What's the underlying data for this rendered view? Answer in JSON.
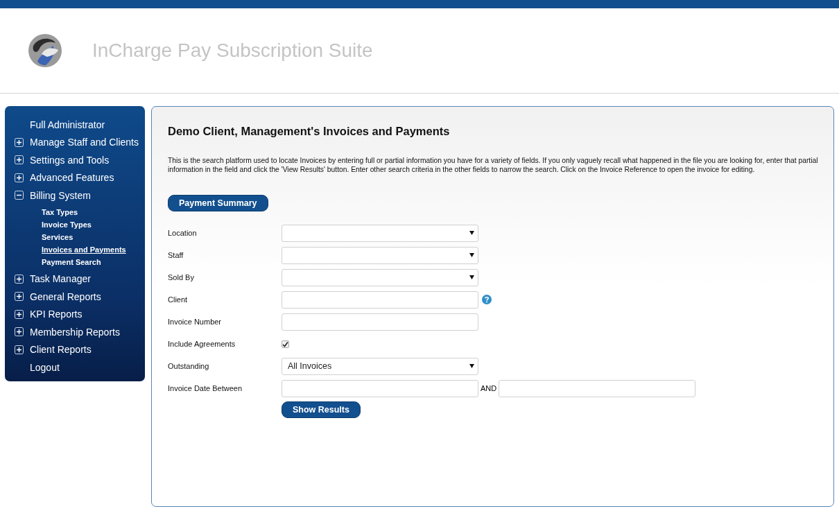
{
  "header": {
    "title": "InCharge Pay Subscription Suite"
  },
  "sidebar": {
    "items": [
      {
        "kind": "plain",
        "label": "Full Administrator"
      },
      {
        "kind": "group",
        "label": "Manage Staff and Clients",
        "expanded": false
      },
      {
        "kind": "group",
        "label": "Settings and Tools",
        "expanded": false
      },
      {
        "kind": "group",
        "label": "Advanced Features",
        "expanded": false
      },
      {
        "kind": "group",
        "label": "Billing System",
        "expanded": true,
        "children": [
          {
            "label": "Tax Types",
            "selected": false
          },
          {
            "label": "Invoice Types",
            "selected": false
          },
          {
            "label": "Services",
            "selected": false
          },
          {
            "label": "Invoices and Payments",
            "selected": true
          },
          {
            "label": "Payment Search",
            "selected": false
          }
        ]
      },
      {
        "kind": "group",
        "label": "Task Manager",
        "expanded": false
      },
      {
        "kind": "group",
        "label": "General Reports",
        "expanded": false
      },
      {
        "kind": "group",
        "label": "KPI Reports",
        "expanded": false
      },
      {
        "kind": "group",
        "label": "Membership Reports",
        "expanded": false
      },
      {
        "kind": "group",
        "label": "Client Reports",
        "expanded": false
      },
      {
        "kind": "plain",
        "label": "Logout"
      }
    ]
  },
  "main": {
    "title": "Demo Client, Management's Invoices and Payments",
    "description": "This is the search platform used to locate Invoices by entering full or partial information you have for a variety of fields. If you only vaguely recall what happened in the file you are looking for, enter that partial information in the field and click the 'View Results' button. Enter other search criteria in the other fields to narrow the search. Click on the Invoice Reference to open the invoice for editing.",
    "summary_button": "Payment Summary",
    "fields": [
      {
        "kind": "select",
        "label": "Location"
      },
      {
        "kind": "select",
        "label": "Staff"
      },
      {
        "kind": "select",
        "label": "Sold By"
      },
      {
        "kind": "text",
        "label": "Client",
        "help": true
      },
      {
        "kind": "text",
        "label": "Invoice Number"
      },
      {
        "kind": "checkbox",
        "label": "Include Agreements",
        "checked": true
      },
      {
        "kind": "select",
        "label": "Outstanding",
        "value": "All Invoices"
      },
      {
        "kind": "daterange",
        "label": "Invoice Date Between",
        "joiner": "AND"
      }
    ],
    "submit_button": "Show Results"
  }
}
